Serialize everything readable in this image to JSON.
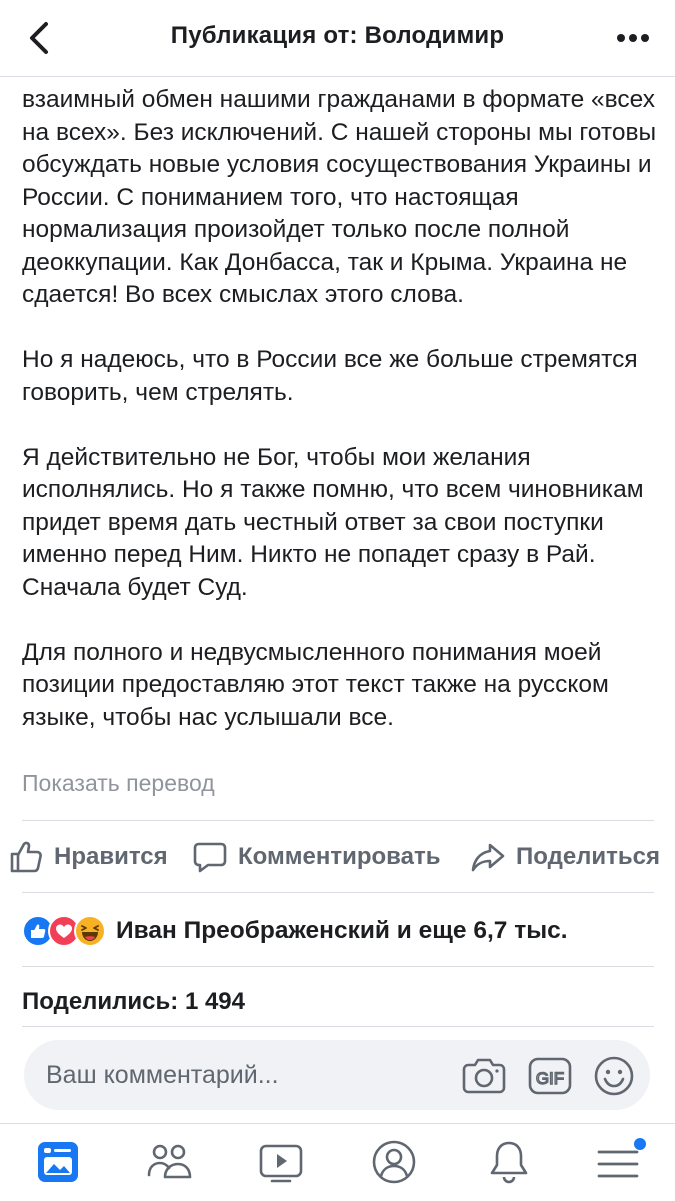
{
  "header": {
    "title": "Публикация от: Володимир",
    "back_icon": "chevron-left-icon",
    "more_icon": "more-dots-icon"
  },
  "post": {
    "paragraphs": [
      "взаимный обмен нашими гражданами в формате «всех на всех». Без исключений. С нашей стороны мы готовы обсуждать новые условия сосуществования Украины и России. С пониманием того, что настоящая нормализация произойдет только после полной деоккупации. Как Донбасса, так и Крыма. Украина не сдается! Во всех смыслах этого слова.",
      "Но я надеюсь, что в России все же больше стремятся говорить, чем стрелять.",
      "Я действительно не Бог, чтобы мои желания исполнялись. Но я также помню, что всем чиновникам придет время дать честный ответ за свои поступки именно перед Ним. Никто не попадет сразу в Рай. Сначала будет Суд.",
      "Для полного и недвусмысленного понимания моей позиции предоставляю этот текст также на русском языке, чтобы нас услышали все."
    ],
    "show_translation": "Показать перевод"
  },
  "actions": {
    "like": "Нравится",
    "comment": "Комментировать",
    "share": "Поделиться"
  },
  "reactions": {
    "text": "Иван Преображенский и еще 6,7 тыс.",
    "icons": [
      "like-reaction-icon",
      "love-reaction-icon",
      "haha-reaction-icon"
    ]
  },
  "shares": {
    "text": "Поделились: 1 494"
  },
  "comment_box": {
    "placeholder": "Ваш комментарий...",
    "icons": [
      "camera-icon",
      "gif-icon",
      "emoji-icon"
    ]
  },
  "tabbar": {
    "items": [
      "news-feed-icon",
      "groups-icon",
      "watch-icon",
      "profile-icon",
      "notifications-icon",
      "menu-icon"
    ],
    "active": "news-feed-icon"
  },
  "colors": {
    "accent": "#1877f2",
    "secondary_text": "#606770",
    "muted_text": "#90949c",
    "love": "#f33e58",
    "haha": "#f7b125",
    "divider": "#dadde1"
  }
}
